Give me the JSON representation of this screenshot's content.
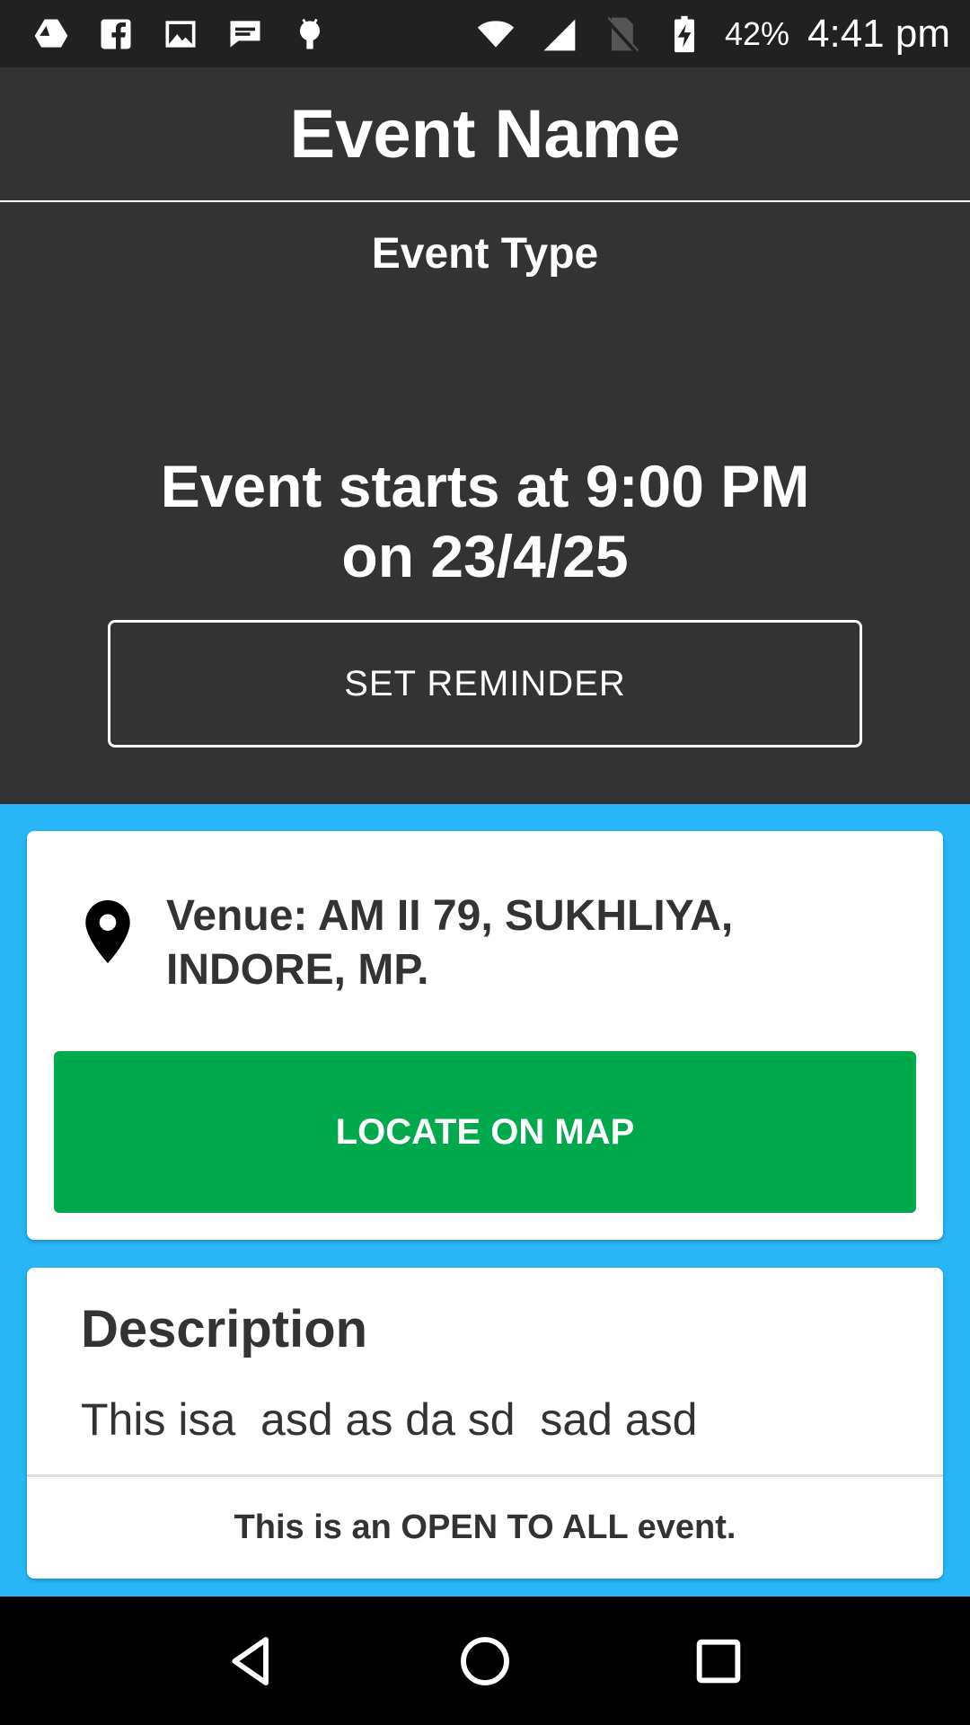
{
  "status_bar": {
    "notification_icons": [
      "drive-icon",
      "facebook-icon",
      "image-icon",
      "chat-icon",
      "android-icon"
    ],
    "system_icons": [
      "wifi-icon",
      "signal-icon",
      "no-sim-icon",
      "battery-charging-icon"
    ],
    "battery": "42%",
    "time": "4:41 pm"
  },
  "header": {
    "event_name": "Event Name"
  },
  "hero": {
    "event_type": "Event Type",
    "start_line1": "Event starts at 9:00 PM",
    "start_line2": "on 23/4/25",
    "reminder_label": "SET REMINDER"
  },
  "venue": {
    "text": "Venue: AM II 79, SUKHLIYA, INDORE, MP.",
    "locate_label": "LOCATE ON MAP"
  },
  "description": {
    "title": "Description",
    "text": "This isa  asd as da sd  sad asd",
    "open_note": "This is an OPEN TO ALL event."
  },
  "colors": {
    "header_bg": "#333333",
    "content_bg": "#29b6f6",
    "locate_button": "#00aa4c",
    "text_dark": "#333333"
  },
  "nav_bar": {
    "icons": [
      "back-icon",
      "home-icon",
      "recents-icon"
    ]
  }
}
